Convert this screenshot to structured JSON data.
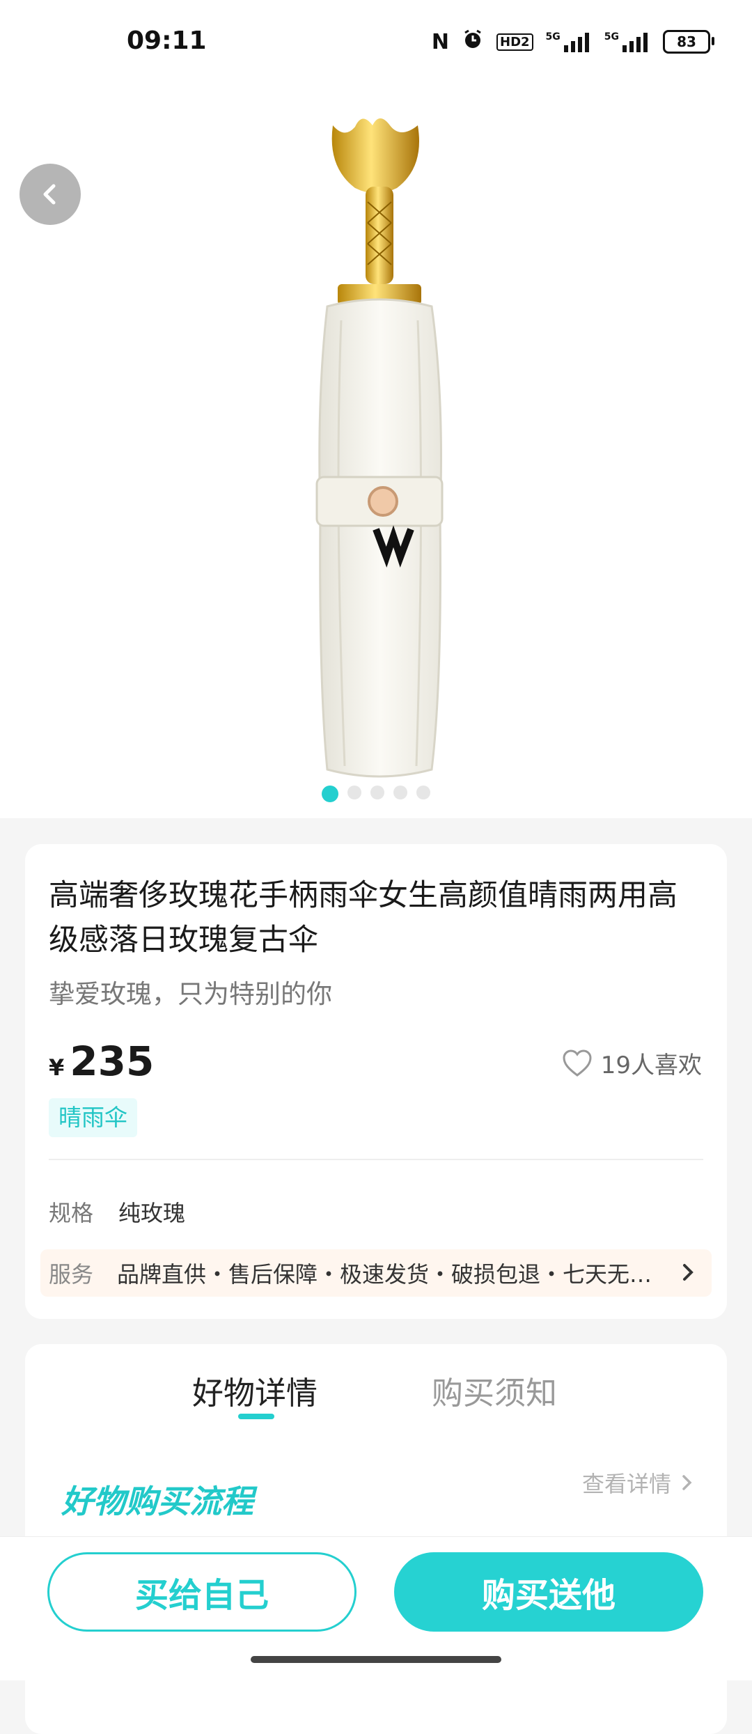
{
  "status_bar": {
    "time": "09:11",
    "signal_labels": [
      "HD2",
      "5G",
      "5G"
    ],
    "battery": "83"
  },
  "product": {
    "image_carousel": {
      "total": 5,
      "active_index": 0
    },
    "title": "高端奢侈玫瑰花手柄雨伞女生高颜值晴雨两用高级感落日玫瑰复古伞",
    "subtitle": "挚爱玫瑰，只为特别的你",
    "currency": "¥",
    "price": "235",
    "likes": "19人喜欢",
    "tag": "晴雨伞",
    "spec_label": "规格",
    "spec_value": "纯玫瑰",
    "service_label": "服务",
    "service_text": "品牌直供・售后保障・极速发货・破损包退・七天无理由退换"
  },
  "details": {
    "tabs": [
      {
        "label": "好物详情",
        "active": true
      },
      {
        "label": "购买须知",
        "active": false
      }
    ],
    "flow_title": "好物购买流程",
    "view_detail": "查看详情"
  },
  "actions": {
    "buy_self": "买给自己",
    "buy_gift": "购买送他"
  },
  "colors": {
    "accent": "#24cfcf",
    "tag_bg": "#e8fbfb",
    "service_bg": "#fff6ef"
  }
}
